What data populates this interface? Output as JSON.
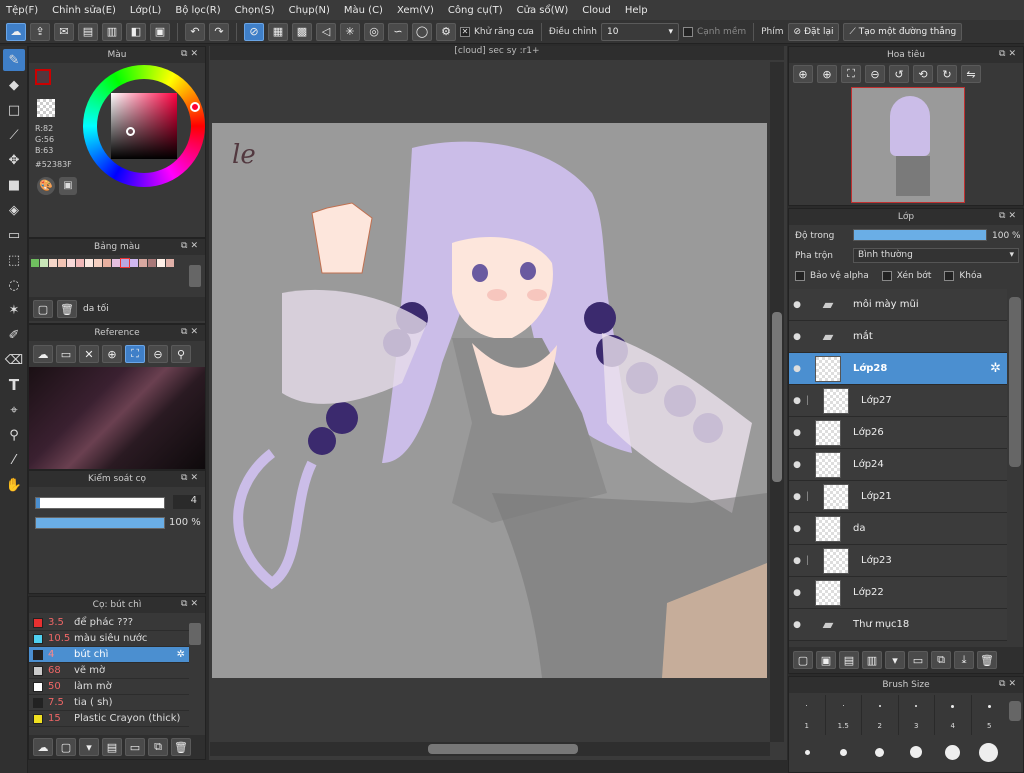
{
  "menu": [
    "Tệp(F)",
    "Chỉnh sửa(E)",
    "Lớp(L)",
    "Bộ lọc(R)",
    "Chọn(S)",
    "Chụp(N)",
    "Màu (C)",
    "Xem(V)",
    "Công cụ(T)",
    "Cửa sổ(W)",
    "Cloud",
    "Help"
  ],
  "toolbar": {
    "antialias": "Khử răng cưa",
    "adjust_label": "Điều chỉnh",
    "adjust_value": "10",
    "soft_edge": "Cạnh mềm",
    "key_label": "Phím",
    "reset": "Đặt lại",
    "straight_line": "Tạo một đường thẳng"
  },
  "color_panel": {
    "title": "Màu",
    "r": "R:82",
    "g": "G:56",
    "b": "B:63",
    "hex": "#52383F",
    "fg": "#52383F",
    "accent": "#3f7fc8"
  },
  "palette_panel": {
    "title": "Bảng màu",
    "palette_name": "da tối",
    "swatches": [
      "#6fbf5f",
      "#c9e6b8",
      "#f5d6c8",
      "#f2c4b4",
      "#f7d8d8",
      "#f0b8b8",
      "#fbe8e0",
      "#f4cfc0",
      "#e8b0a0",
      "#e6c0e0",
      "#b8a8e0",
      "#d0b8f0",
      "#d8a8a0",
      "#a87878",
      "#fff0e8",
      "#e0b0a8"
    ]
  },
  "reference_panel": {
    "title": "Reference"
  },
  "brush_control": {
    "title": "Kiểm soát cọ",
    "size": "4",
    "opacity": "100 %",
    "opacity_fraction": 1.0
  },
  "brush_list": {
    "title": "Cọ: bút chì",
    "items": [
      {
        "size": "3.5",
        "name": "để phác ???",
        "color": "#e83030"
      },
      {
        "size": "10.5",
        "name": "màu siêu nước",
        "color": "#4fd0f0"
      },
      {
        "size": "4",
        "name": "bút chì",
        "color": "#222222",
        "selected": true
      },
      {
        "size": "68",
        "name": "vẽ mờ",
        "color": "#cccccc"
      },
      {
        "size": "50",
        "name": "làm mờ",
        "color": "#ffffff"
      },
      {
        "size": "7.5",
        "name": "tia ( sh)",
        "color": "#222222"
      },
      {
        "size": "15",
        "name": "Plastic Crayon (thick)",
        "color": "#f0e020"
      }
    ]
  },
  "canvas": {
    "tab_title": "[cloud] sec sy :r1+",
    "signature": "le"
  },
  "navigator": {
    "title": "Hoa tiêu"
  },
  "layers_panel": {
    "title": "Lớp",
    "opacity_label": "Độ trong",
    "opacity_value": "100 %",
    "opacity_fraction": 1.0,
    "blend_label": "Pha trộn",
    "blend_value": "Bình thường",
    "protect_alpha": "Bảo vệ alpha",
    "clip": "Xén bớt",
    "lock": "Khóa",
    "layers": [
      {
        "name": "môi mày mũi",
        "type": "folder"
      },
      {
        "name": "mắt",
        "type": "folder"
      },
      {
        "name": "Lớp28",
        "type": "layer",
        "selected": true
      },
      {
        "name": "Lớp27",
        "type": "layer",
        "clip": true
      },
      {
        "name": "Lớp26",
        "type": "layer"
      },
      {
        "name": "Lớp24",
        "type": "layer"
      },
      {
        "name": "Lớp21",
        "type": "layer",
        "clip": true
      },
      {
        "name": "da",
        "type": "layer"
      },
      {
        "name": "Lớp23",
        "type": "layer",
        "clip": true
      },
      {
        "name": "Lớp22",
        "type": "layer"
      },
      {
        "name": "Thư mục18",
        "type": "folder"
      }
    ]
  },
  "brush_size_panel": {
    "title": "Brush Size",
    "labels": [
      "1",
      "1.5",
      "2",
      "3",
      "4",
      "5"
    ]
  }
}
